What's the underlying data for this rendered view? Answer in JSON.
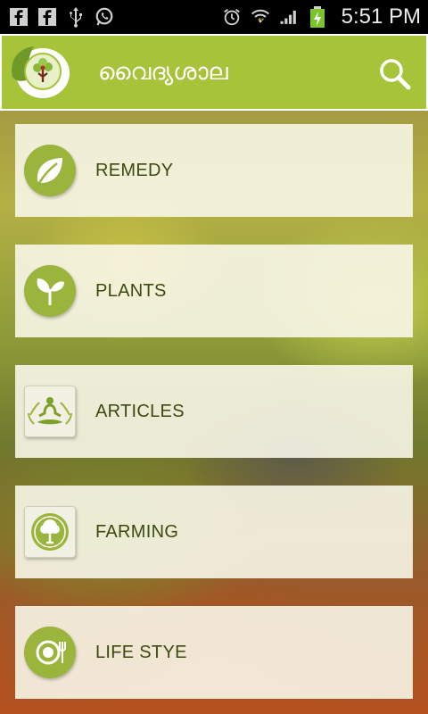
{
  "status_bar": {
    "time": "5:51 PM",
    "left_icons": [
      "facebook-icon",
      "facebook-icon",
      "usb-icon",
      "whatsapp-icon"
    ],
    "right_icons": [
      "alarm-icon",
      "wifi-icon",
      "signal-icon",
      "battery-charging-icon"
    ]
  },
  "app_bar": {
    "title": "വൈദ്യശാല",
    "logo": "app-logo-icon",
    "search_icon": "search-icon",
    "color": "#a6c33a"
  },
  "menu": {
    "items": [
      {
        "label": "REMEDY",
        "icon": "leaf-icon"
      },
      {
        "label": "PLANTS",
        "icon": "sprout-icon"
      },
      {
        "label": "ARTICLES",
        "icon": "meditation-icon"
      },
      {
        "label": "FARMING",
        "icon": "tree-icon"
      },
      {
        "label": "LIFE STYE",
        "icon": "food-plate-icon"
      }
    ]
  },
  "colors": {
    "accent": "#a6c33a",
    "icon_green": "#9bb43c",
    "label_text": "#3c4a10"
  }
}
